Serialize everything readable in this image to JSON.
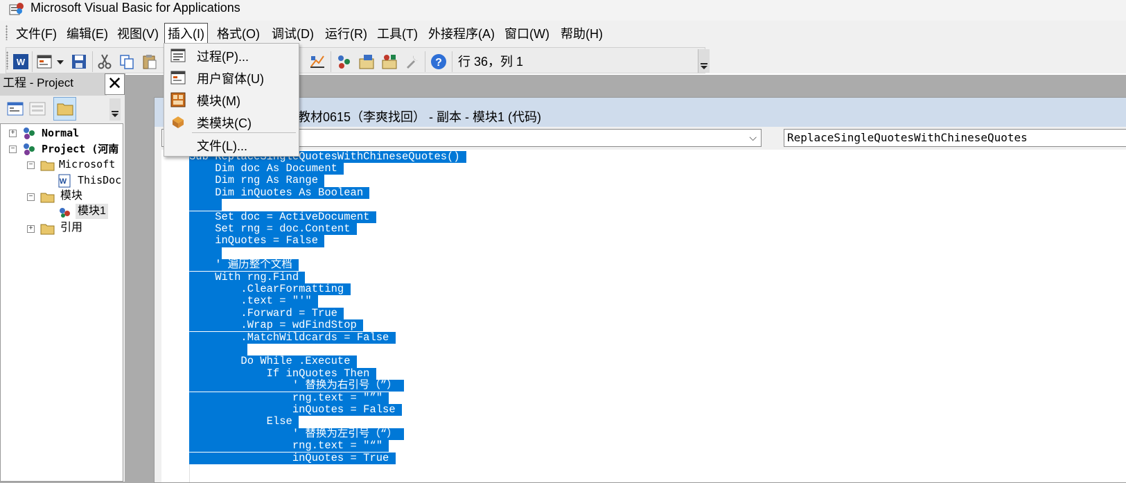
{
  "window": {
    "title": "Microsoft Visual Basic for Applications"
  },
  "menubar": {
    "items": [
      "文件(F)",
      "编辑(E)",
      "视图(V)",
      "插入(I)",
      "格式(O)",
      "调试(D)",
      "运行(R)",
      "工具(T)",
      "外接程序(A)",
      "窗口(W)",
      "帮助(H)"
    ],
    "active_item": "插入(I)"
  },
  "insert_menu": {
    "items": [
      "过程(P)...",
      "用户窗体(U)",
      "模块(M)",
      "类模块(C)",
      "文件(L)..."
    ]
  },
  "toolbar": {
    "status": "行 36，列 1",
    "icons": [
      "word-icon",
      "userform-icon",
      "dropdown-arrow-icon",
      "save-icon",
      "cut-icon",
      "copy-icon",
      "paste-icon",
      "design-mode-icon",
      "project-explorer-icon",
      "properties-icon",
      "object-browser-icon",
      "toolbox-icon",
      "help-icon"
    ]
  },
  "project_panel": {
    "title": "工程 - Project",
    "close_glyph": "✕",
    "tree": [
      {
        "label": "Normal",
        "expander": "+"
      },
      {
        "label": "Project (河南",
        "expander": "−"
      },
      {
        "label": "Microsoft",
        "expander": "−"
      },
      {
        "label": "ThisDoc"
      },
      {
        "label": "模块",
        "expander": "−"
      },
      {
        "label": "模块1"
      },
      {
        "label": "引用",
        "expander": "+"
      }
    ]
  },
  "code_window": {
    "title": "教材0615（李爽找回） - 副本 - 模块1 (代码)",
    "object_combo": "",
    "procedure_combo": "ReplaceSingleQuotesWithChineseQuotes",
    "code_lines": [
      "Sub ReplaceSingleQuotesWithChineseQuotes() ",
      "    Dim doc As Document ",
      "    Dim rng As Range ",
      "    Dim inQuotes As Boolean ",
      "     ",
      "    Set doc = ActiveDocument ",
      "    Set rng = doc.Content ",
      "    inQuotes = False ",
      "     ",
      "    ' 遍历整个文档 ",
      "    With rng.Find ",
      "        .ClearFormatting ",
      "        .text = \"'\" ",
      "        .Forward = True ",
      "        .Wrap = wdFindStop ",
      "        .MatchWildcards = False ",
      "         ",
      "        Do While .Execute ",
      "            If inQuotes Then ",
      "                ' 替换为右引号（”） ",
      "                rng.text = \"”\" ",
      "                inQuotes = False ",
      "            Else ",
      "                ' 替换为左引号（“） ",
      "                rng.text = \"“\" ",
      "                inQuotes = True "
    ]
  }
}
